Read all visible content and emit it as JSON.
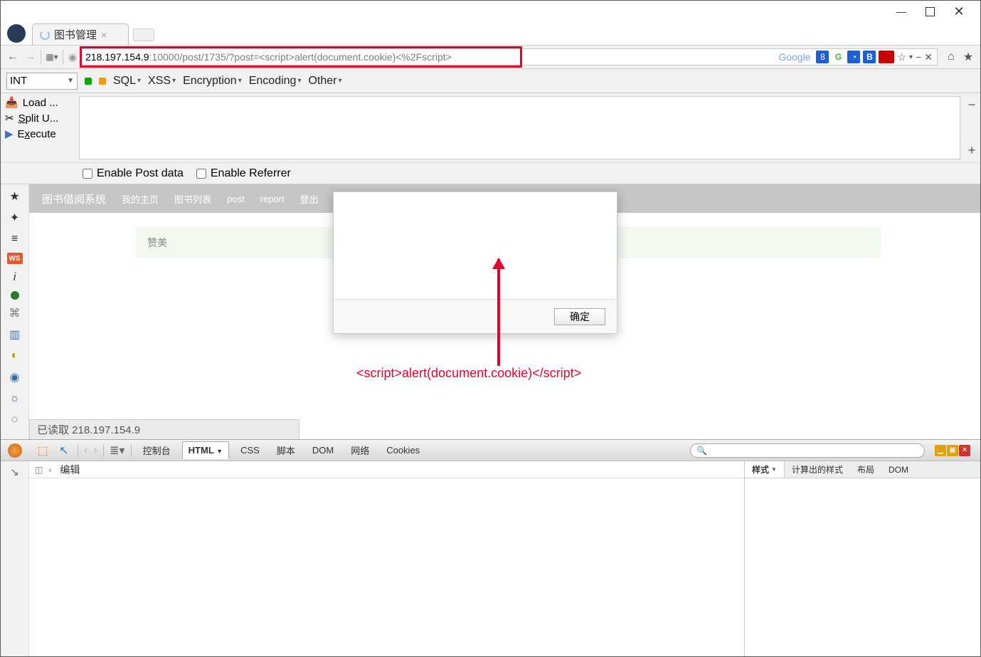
{
  "window": {
    "tab_title": "图书管理"
  },
  "navbar": {
    "url_ip": "218.197.154.9",
    "url_rest": ":10000/post/1735/?post=<script>alert(document.cookie)<%2Fscript>",
    "google_label": "Google"
  },
  "hackbar": {
    "int_label": "INT",
    "menu": [
      "SQL",
      "XSS",
      "Encryption",
      "Encoding",
      "Other"
    ],
    "load": "Load ...",
    "split": "Split U...",
    "execute": "Execute",
    "enable_post": "Enable Post data",
    "enable_referrer": "Enable Referrer"
  },
  "webpage": {
    "brand": "图书借阅系统",
    "nav_items": [
      "我的主页",
      "图书列表",
      "post",
      "report",
      "登出"
    ],
    "content_placeholder": "赞美"
  },
  "alert": {
    "ok": "确定"
  },
  "annotation": {
    "caption": "<script>alert(document.cookie)</script>"
  },
  "status": {
    "text": "已读取 218.197.154.9"
  },
  "firebug": {
    "tabs": [
      "控制台",
      "HTML",
      "CSS",
      "脚本",
      "DOM",
      "网络",
      "Cookies"
    ],
    "active_tab": "HTML",
    "edit_label": "编辑",
    "side_tabs": [
      "样式",
      "计算出的样式",
      "布局",
      "DOM"
    ],
    "side_active": "样式"
  }
}
